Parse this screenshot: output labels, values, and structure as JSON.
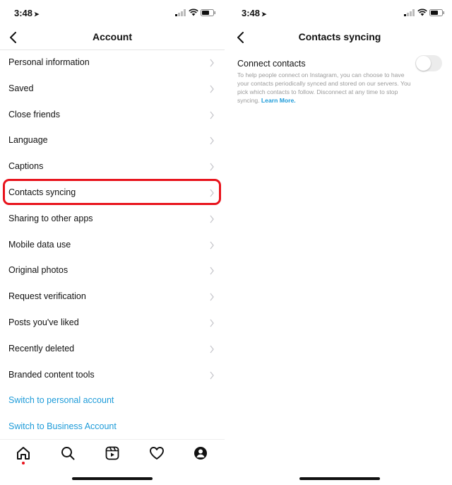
{
  "status_bar": {
    "time": "3:48"
  },
  "left_screen": {
    "title": "Account",
    "menu_items": [
      "Personal information",
      "Saved",
      "Close friends",
      "Language",
      "Captions",
      "Contacts syncing",
      "Sharing to other apps",
      "Mobile data use",
      "Original photos",
      "Request verification",
      "Posts you've liked",
      "Recently deleted",
      "Branded content tools"
    ],
    "links": [
      "Switch to personal account",
      "Switch to Business Account"
    ],
    "highlighted_item": "Contacts syncing",
    "tabs": [
      "home-icon",
      "search-icon",
      "reels-icon",
      "heart-icon",
      "profile-icon"
    ]
  },
  "right_screen": {
    "title": "Contacts syncing",
    "setting_label": "Connect contacts",
    "setting_description": "To help people connect on Instagram, you can choose to have your contacts periodically synced and stored on our servers. You pick which contacts to follow. Disconnect at any time to stop syncing.",
    "learn_more": "Learn More.",
    "toggle_on": false
  },
  "colors": {
    "link": "#1d9bd9",
    "highlight": "#e8121b",
    "chevron": "#c7c7cc"
  }
}
